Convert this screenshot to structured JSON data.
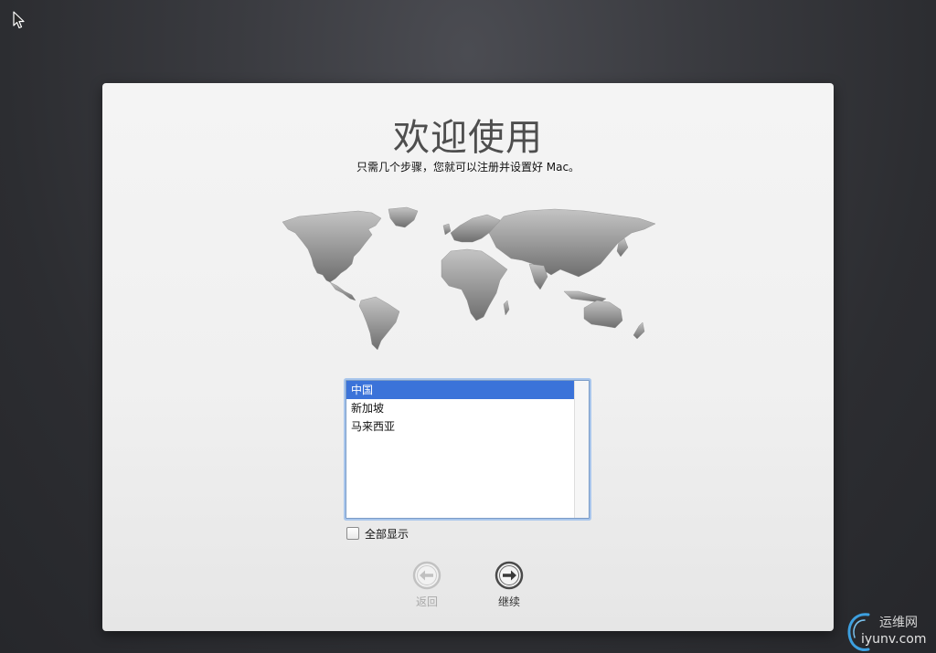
{
  "header": {
    "title": "欢迎使用",
    "subtitle": "只需几个步骤，您就可以注册并设置好 Mac。"
  },
  "country_list": {
    "items": [
      "中国",
      "新加坡",
      "马来西亚"
    ],
    "selected": "中国"
  },
  "show_all": {
    "label": "全部显示",
    "checked": false
  },
  "nav": {
    "back_label": "返回",
    "back_enabled": false,
    "continue_label": "继续"
  },
  "watermark": {
    "text_cn": "运维网",
    "text_en": "iyunv.com"
  },
  "icons": {
    "cursor": "arrow-cursor-icon",
    "map": "world-map-icon",
    "back": "left-arrow-circle-icon",
    "continue": "right-arrow-circle-icon",
    "watermark": "swirl-logo-icon"
  },
  "colors": {
    "selection": "#3b73d9",
    "focus_ring": "#a9c6ec"
  }
}
